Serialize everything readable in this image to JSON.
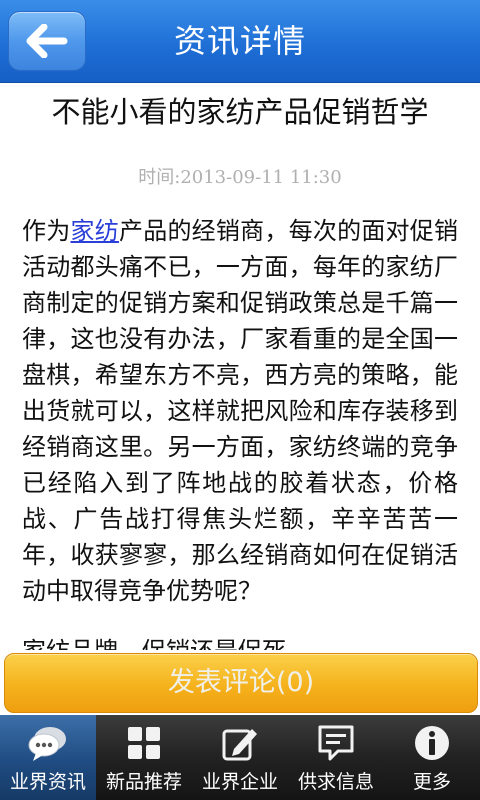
{
  "header": {
    "title": "资讯详情",
    "back_icon": "back-arrow-icon"
  },
  "article": {
    "title": "不能小看的家纺产品促销哲学",
    "time": "时间:2013-09-11 11:30",
    "body_prefix": "作为",
    "body_link": "家纺",
    "body_rest": "产品的经销商，每次的面对促销活动都头痛不已，一方面，每年的家纺厂商制定的促销方案和促销政策总是千篇一律，这也没有办法，厂家看重的是全国一盘棋，希望东方不亮，西方亮的策略，能出货就可以，这样就把风险和库存装移到经销商这里。另一方面，家纺终端的竞争已经陷入到了阵地战的胶着状态，价格战、广告战打得焦头烂额，辛辛苦苦一年，收获寥寥，那么经销商如何在促销活动中取得竞争优势呢？",
    "subheading": "家纺品牌，促销还是促死"
  },
  "comment": {
    "label": "发表评论(0)"
  },
  "nav": {
    "items": [
      {
        "label": "业界资讯",
        "icon": "chat-bubbles-icon",
        "active": true
      },
      {
        "label": "新品推荐",
        "icon": "grid-icon",
        "active": false
      },
      {
        "label": "业界企业",
        "icon": "edit-icon",
        "active": false
      },
      {
        "label": "供求信息",
        "icon": "message-icon",
        "active": false
      },
      {
        "label": "更多",
        "icon": "info-icon",
        "active": false
      }
    ]
  },
  "colors": {
    "header": "#1f6fd6",
    "comment_button": "#f5b21c",
    "nav_active": "#1f4c82",
    "link": "#2a3fd8"
  }
}
